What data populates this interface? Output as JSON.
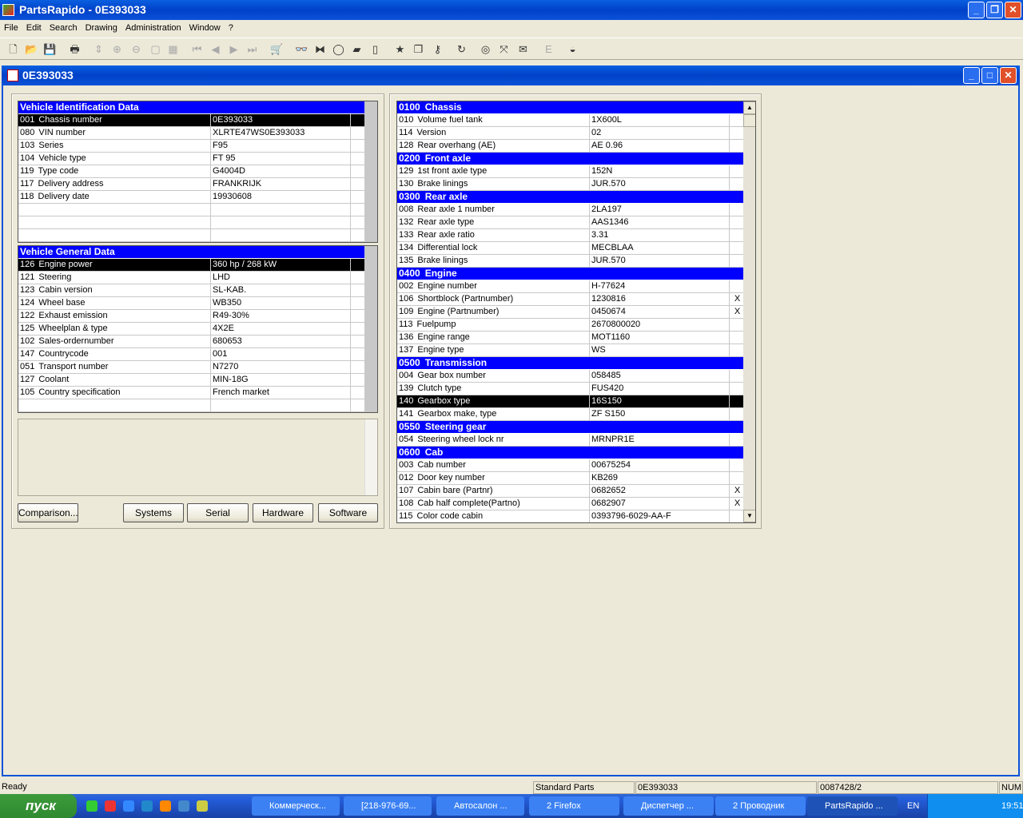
{
  "app": {
    "title": "PartsRapido - 0E393033"
  },
  "menu": [
    "File",
    "Edit",
    "Search",
    "Drawing",
    "Administration",
    "Window",
    "?"
  ],
  "toolbar_icons": [
    "new-icon",
    "open-icon",
    "save-icon",
    "print-icon",
    "fit-icon",
    "zoom-in-icon",
    "zoom-out-icon",
    "page-icon",
    "grid-icon",
    "first-icon",
    "prev-icon",
    "next-icon",
    "last-icon",
    "cart-icon",
    "binoculars-icon",
    "connector-icon",
    "ring-icon",
    "tap-icon",
    "bottle-icon",
    "star-icon",
    "copy-alert-icon",
    "key-icon",
    "refresh-icon",
    "target-icon",
    "expand-icon",
    "mail-icon",
    "e-icon",
    "logo-icon"
  ],
  "child": {
    "title": "0E393033"
  },
  "ident": {
    "title": "Vehicle Identification Data",
    "rows": [
      {
        "code": "001",
        "label": "Chassis number",
        "value": "0E393033",
        "sel": true
      },
      {
        "code": "080",
        "label": "VIN number",
        "value": "XLRTE47WS0E393033"
      },
      {
        "code": "103",
        "label": "Series",
        "value": "F95"
      },
      {
        "code": "104",
        "label": "Vehicle type",
        "value": "FT 95"
      },
      {
        "code": "119",
        "label": "Type code",
        "value": "G4004D"
      },
      {
        "code": "117",
        "label": "Delivery address",
        "value": "FRANKRIJK"
      },
      {
        "code": "118",
        "label": "Delivery date",
        "value": "19930608"
      },
      {
        "code": "",
        "label": "",
        "value": ""
      },
      {
        "code": "",
        "label": "",
        "value": ""
      },
      {
        "code": "",
        "label": "",
        "value": ""
      }
    ]
  },
  "general": {
    "title": "Vehicle General Data",
    "rows": [
      {
        "code": "126",
        "label": "Engine power",
        "value": "360 hp / 268 kW",
        "sel": true
      },
      {
        "code": "121",
        "label": "Steering",
        "value": "LHD"
      },
      {
        "code": "123",
        "label": "Cabin version",
        "value": "SL-KAB."
      },
      {
        "code": "124",
        "label": "Wheel base",
        "value": "WB350"
      },
      {
        "code": "122",
        "label": "Exhaust emission",
        "value": "R49-30%"
      },
      {
        "code": "125",
        "label": "Wheelplan & type",
        "value": "4X2E"
      },
      {
        "code": "102",
        "label": "Sales-ordernumber",
        "value": "680653"
      },
      {
        "code": "147",
        "label": "Countrycode",
        "value": "001"
      },
      {
        "code": "051",
        "label": "Transport number",
        "value": "N7270"
      },
      {
        "code": "127",
        "label": "Coolant",
        "value": "MIN-18G"
      },
      {
        "code": "105",
        "label": "Country specification",
        "value": "French market"
      },
      {
        "code": "",
        "label": "",
        "value": ""
      }
    ]
  },
  "buttons": {
    "comparison": "Comparison...",
    "systems": "Systems",
    "serial": "Serial",
    "hardware": "Hardware",
    "software": "Software"
  },
  "spec": {
    "rows": [
      {
        "hdr": true,
        "code": "0100",
        "label": "Chassis"
      },
      {
        "code": "010",
        "label": "Volume fuel tank",
        "value": "1X600L",
        "x": ""
      },
      {
        "code": "114",
        "label": "Version",
        "value": "02",
        "x": ""
      },
      {
        "code": "128",
        "label": "Rear overhang (AE)",
        "value": "AE 0.96",
        "x": ""
      },
      {
        "hdr": true,
        "code": "0200",
        "label": "Front axle"
      },
      {
        "code": "129",
        "label": "1st front axle type",
        "value": "152N",
        "x": ""
      },
      {
        "code": "130",
        "label": "Brake linings",
        "value": "JUR.570",
        "x": ""
      },
      {
        "hdr": true,
        "code": "0300",
        "label": "Rear axle"
      },
      {
        "code": "008",
        "label": "Rear axle 1 number",
        "value": "2LA197",
        "x": ""
      },
      {
        "code": "132",
        "label": "Rear axle type",
        "value": "AAS1346",
        "x": ""
      },
      {
        "code": "133",
        "label": "Rear axle ratio",
        "value": "3.31",
        "x": ""
      },
      {
        "code": "134",
        "label": "Differential lock",
        "value": "MECBLAA",
        "x": ""
      },
      {
        "code": "135",
        "label": "Brake linings",
        "value": "JUR.570",
        "x": ""
      },
      {
        "hdr": true,
        "code": "0400",
        "label": "Engine"
      },
      {
        "code": "002",
        "label": "Engine number",
        "value": "H-77624",
        "x": ""
      },
      {
        "code": "106",
        "label": "Shortblock (Partnumber)",
        "value": "1230816",
        "x": "X"
      },
      {
        "code": "109",
        "label": "Engine (Partnumber)",
        "value": "0450674",
        "x": "X"
      },
      {
        "code": "113",
        "label": "Fuelpump",
        "value": "2670800020",
        "x": ""
      },
      {
        "code": "136",
        "label": "Engine range",
        "value": "MOT1160",
        "x": ""
      },
      {
        "code": "137",
        "label": "Engine type",
        "value": "WS",
        "x": ""
      },
      {
        "hdr": true,
        "code": "0500",
        "label": "Transmission"
      },
      {
        "code": "004",
        "label": "Gear box number",
        "value": "058485",
        "x": ""
      },
      {
        "code": "139",
        "label": "Clutch type",
        "value": "FUS420",
        "x": ""
      },
      {
        "code": "140",
        "label": "Gearbox type",
        "value": "16S150",
        "x": "",
        "sel": true
      },
      {
        "code": "141",
        "label": "Gearbox make, type",
        "value": "ZF S150",
        "x": ""
      },
      {
        "hdr": true,
        "code": "0550",
        "label": "Steering gear"
      },
      {
        "code": "054",
        "label": "Steering wheel lock nr",
        "value": "MRNPR1E",
        "x": ""
      },
      {
        "hdr": true,
        "code": "0600",
        "label": "Cab"
      },
      {
        "code": "003",
        "label": "Cab number",
        "value": "00675254",
        "x": ""
      },
      {
        "code": "012",
        "label": "Door key number",
        "value": "KB269",
        "x": ""
      },
      {
        "code": "107",
        "label": "Cabin bare (Partnr)",
        "value": "0682652",
        "x": "X"
      },
      {
        "code": "108",
        "label": "Cab half complete(Partno)",
        "value": "0682907",
        "x": "X"
      },
      {
        "code": "115",
        "label": "Color code cabin",
        "value": "0393796-6029-AA-F",
        "x": ""
      }
    ]
  },
  "status": {
    "ready": "Ready",
    "mode": "Standard Parts",
    "chassis": "0E393033",
    "ref": "0087428/2",
    "num": "NUM"
  },
  "taskbar": {
    "start": "пуск",
    "tasks": [
      "Коммерческ...",
      "[218-976-69...",
      "Автосалон ...",
      "2 Firefox",
      "Диспетчер ...",
      "2 Проводник",
      "PartsRapido ..."
    ],
    "lang": "EN",
    "clock": "19:51"
  }
}
